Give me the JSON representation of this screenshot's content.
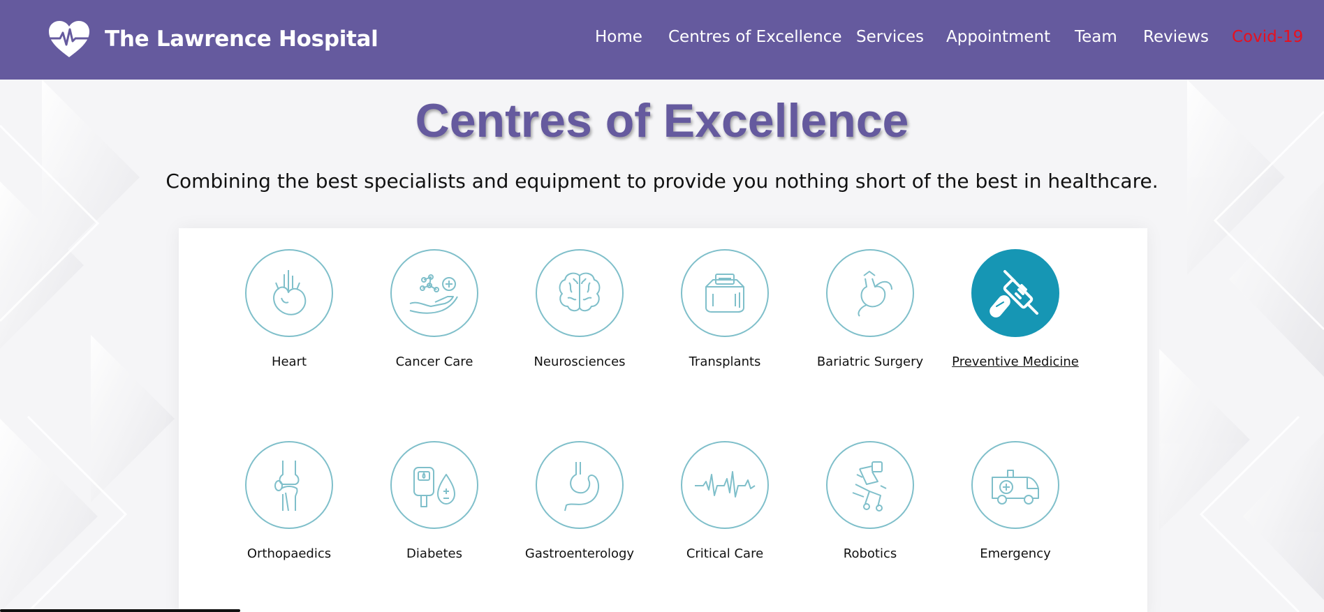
{
  "header": {
    "brand": "The Lawrence Hospital",
    "nav": [
      {
        "label": "Home"
      },
      {
        "label": "Centres of Excellence"
      },
      {
        "label": "Services"
      },
      {
        "label": "Appointment"
      },
      {
        "label": "Team"
      },
      {
        "label": "Reviews"
      },
      {
        "label": "Covid-19"
      }
    ]
  },
  "main": {
    "title": "Centres of Excellence",
    "subtitle": "Combining the best specialists and equipment to provide you nothing short of the best in healthcare.",
    "centres": [
      {
        "label": "Heart",
        "icon": "heart-organ-icon"
      },
      {
        "label": "Cancer Care",
        "icon": "cancer-care-icon"
      },
      {
        "label": "Neurosciences",
        "icon": "brain-icon"
      },
      {
        "label": "Transplants",
        "icon": "organ-box-icon"
      },
      {
        "label": "Bariatric Surgery",
        "icon": "stomach-band-icon"
      },
      {
        "label": "Preventive Medicine",
        "icon": "syringe-pill-icon"
      },
      {
        "label": "Orthopaedics",
        "icon": "knee-joint-icon"
      },
      {
        "label": "Diabetes",
        "icon": "glucose-meter-icon"
      },
      {
        "label": "Gastroenterology",
        "icon": "stomach-icon"
      },
      {
        "label": "Critical Care",
        "icon": "heartbeat-line-icon"
      },
      {
        "label": "Robotics",
        "icon": "surgical-robot-icon"
      },
      {
        "label": "Emergency",
        "icon": "ambulance-icon"
      }
    ]
  },
  "colors": {
    "header_bg": "#655a9e",
    "accent_teal": "#1696b4",
    "icon_stroke": "#7fbfca",
    "covid_red": "#e8101e"
  }
}
